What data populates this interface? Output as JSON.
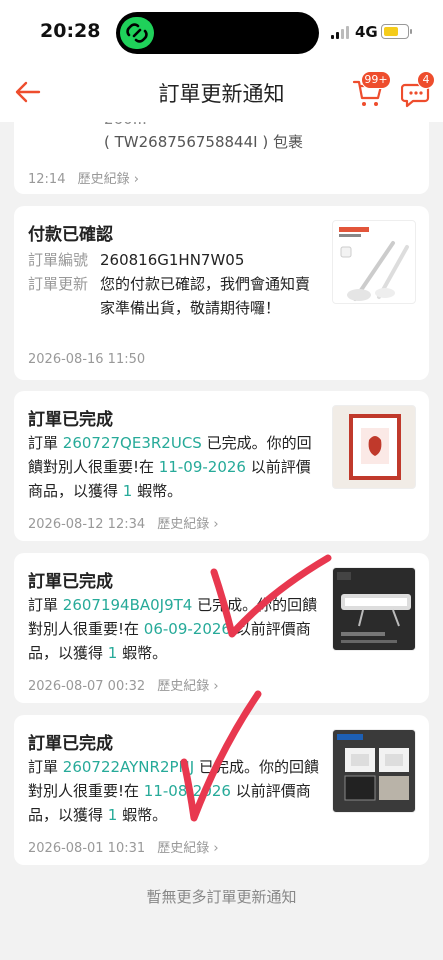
{
  "status_bar": {
    "time": "20:28",
    "network": "4G"
  },
  "header": {
    "title": "訂單更新通知",
    "cart_badge": "99+",
    "chat_badge": "4"
  },
  "cards": [
    {
      "line1": "260...",
      "line2": "( TW268756758844I ) 包裹",
      "time": "12:14",
      "history": "歷史紀錄 ›"
    },
    {
      "title": "付款已確認",
      "order_label": "訂單編號",
      "order_no": "260816G1HN7W05",
      "update_label": "訂單更新",
      "update_text": "您的付款已確認，我們會通知賣家準備出貨，敬請期待囉！",
      "time": "2026-08-16 11:50"
    },
    {
      "title": "訂單已完成",
      "prefix": "訂單 ",
      "order_no": "260727QE3R2UCS",
      "mid": " 已完成。你的回饋對別人很重要!在 ",
      "date": "11-09-2026",
      "after": " 以前評價商品，以獲得 ",
      "coins": "1",
      "end": " 蝦幣。",
      "time": "2026-08-12 12:34",
      "history": "歷史紀錄 ›"
    },
    {
      "title": "訂單已完成",
      "prefix": "訂單 ",
      "order_no": "2607194BA0J9T4",
      "mid": " 已完成。你的回饋對別人很重要!在 ",
      "date": "06-09-2026",
      "after": " 以前評價商品，以獲得 ",
      "coins": "1",
      "end": " 蝦幣。",
      "time": "2026-08-07 00:32",
      "history": "歷史紀錄 ›"
    },
    {
      "title": "訂單已完成",
      "prefix": "訂單 ",
      "order_no": "260722AYNR2PNJ",
      "mid": " 已完成。你的回饋對別人很重要!在 ",
      "date": "11-08-2026",
      "after": " 以前評價商品，以獲得 ",
      "coins": "1",
      "end": " 蝦幣。",
      "time": "2026-08-01 10:31",
      "history": "歷史紀錄 ›"
    }
  ],
  "end_note": "暫無更多訂單更新通知",
  "colors": {
    "accent": "#ee4d2d",
    "link": "#26aa99",
    "checkmark": "#e8384f"
  }
}
